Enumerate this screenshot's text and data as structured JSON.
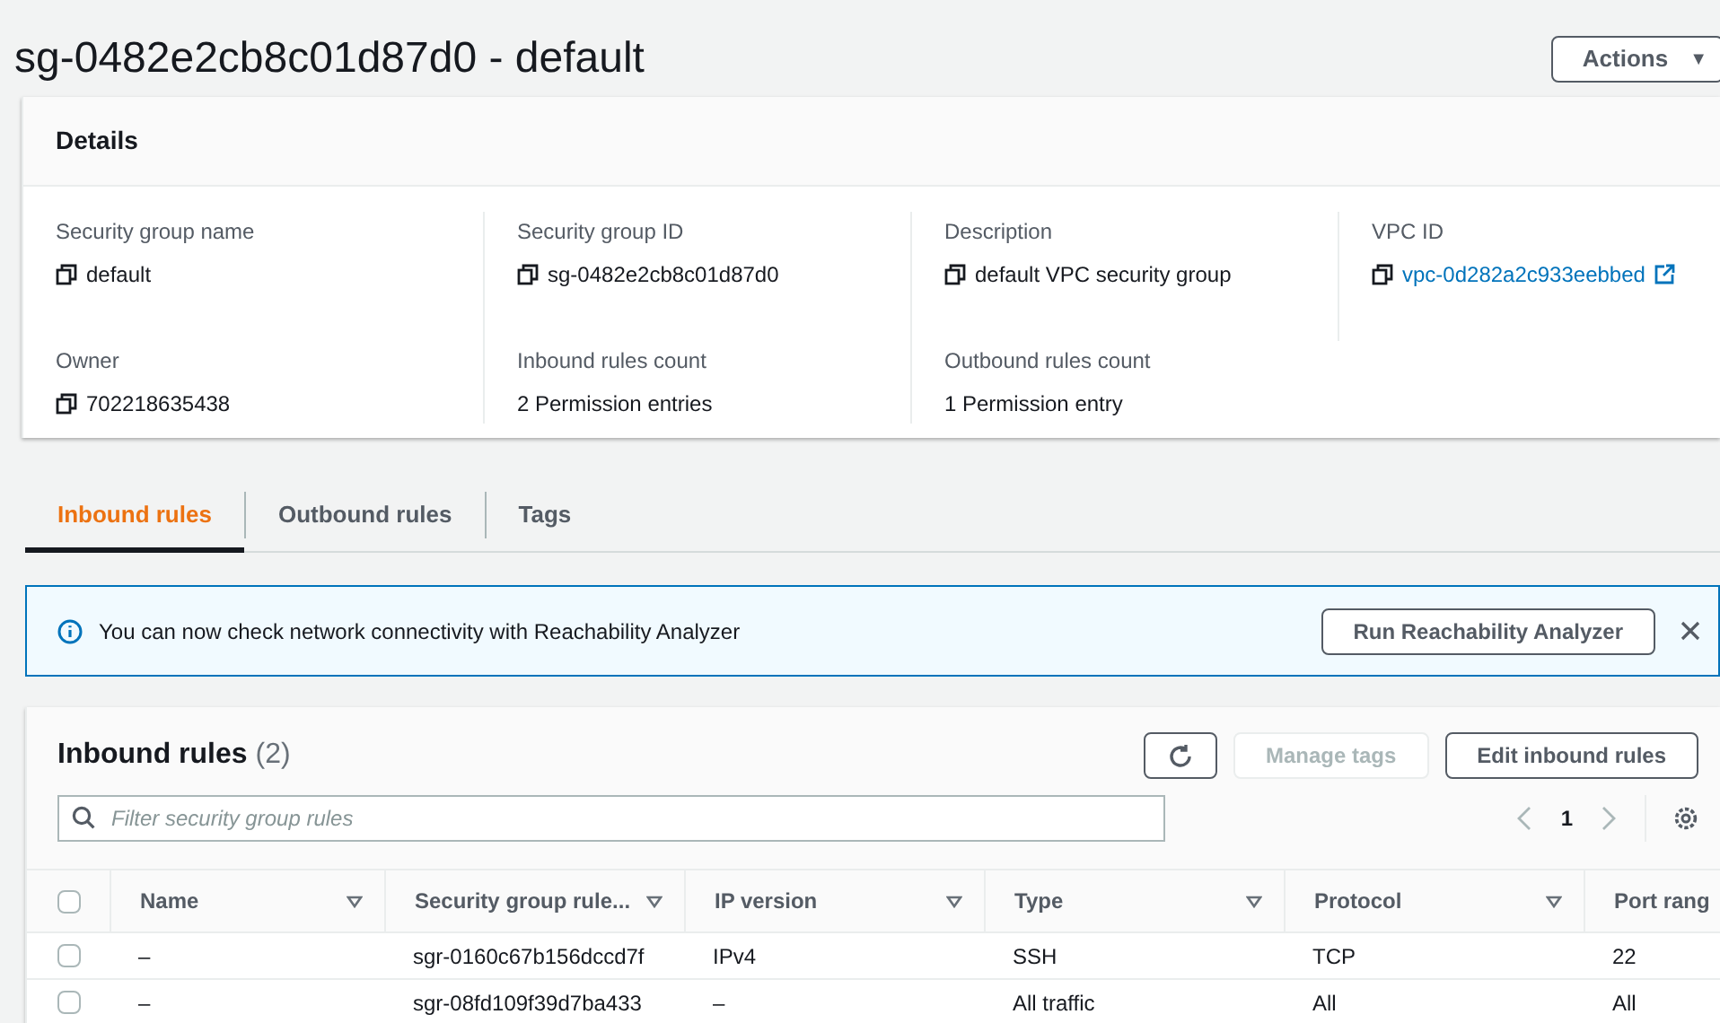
{
  "page_title": "sg-0482e2cb8c01d87d0 - default",
  "actions_button": "Actions",
  "actions_caret": "▼",
  "details": {
    "title": "Details",
    "fields": [
      {
        "label": "Security group name",
        "value": "default",
        "kind": "copy"
      },
      {
        "label": "Security group ID",
        "value": "sg-0482e2cb8c01d87d0",
        "kind": "copy"
      },
      {
        "label": "Description",
        "value": "default VPC security group",
        "kind": "copy"
      },
      {
        "label": "VPC ID",
        "value": "vpc-0d282a2c933eebbed",
        "kind": "link"
      },
      {
        "label": "Owner",
        "value": "702218635438",
        "kind": "copy"
      },
      {
        "label": "Inbound rules count",
        "value": "2 Permission entries",
        "kind": "plain"
      },
      {
        "label": "Outbound rules count",
        "value": "1 Permission entry",
        "kind": "plain"
      }
    ]
  },
  "tabs": [
    {
      "label": "Inbound rules",
      "selected": true
    },
    {
      "label": "Outbound rules",
      "selected": false
    },
    {
      "label": "Tags",
      "selected": false
    }
  ],
  "info_banner": {
    "text": "You can now check network connectivity with Reachability Analyzer",
    "button": "Run Reachability Analyzer"
  },
  "table": {
    "title": "Inbound rules",
    "count": "(2)",
    "buttons": [
      {
        "label": "Manage tags",
        "disabled": true
      },
      {
        "label": "Edit inbound rules",
        "disabled": false
      }
    ],
    "all_checked": false,
    "filter": {
      "placeholder": "Filter security group rules"
    },
    "page": "1",
    "columns": [
      {
        "label": "Name",
        "sortable": true
      },
      {
        "label": "Security group rule...",
        "sortable": true
      },
      {
        "label": "IP version",
        "sortable": true
      },
      {
        "label": "Type",
        "sortable": true
      },
      {
        "label": "Protocol",
        "sortable": true
      },
      {
        "label": "Port rang",
        "sortable": false
      }
    ],
    "rows": [
      {
        "checked": false,
        "cells": [
          "–",
          "sgr-0160c67b156dccd7f",
          "IPv4",
          "SSH",
          "TCP",
          "22"
        ]
      },
      {
        "checked": false,
        "cells": [
          "–",
          "sgr-08fd109f39d7ba433",
          "–",
          "All traffic",
          "All",
          "All"
        ]
      }
    ]
  }
}
